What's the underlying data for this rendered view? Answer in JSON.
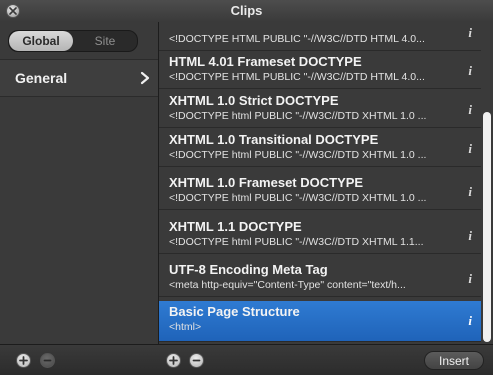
{
  "window": {
    "title": "Clips"
  },
  "scope_tabs": [
    {
      "label": "Global",
      "active": true
    },
    {
      "label": "Site",
      "active": false
    }
  ],
  "categories": [
    {
      "label": "General",
      "selected": true
    }
  ],
  "clips": [
    {
      "name": "",
      "snippet": "<!DOCTYPE HTML PUBLIC \"-//W3C//DTD HTML 4.0...",
      "info": "i",
      "selected": false
    },
    {
      "name": "HTML 4.01 Frameset DOCTYPE",
      "snippet": "<!DOCTYPE HTML PUBLIC \"-//W3C//DTD HTML 4.0...",
      "info": "i",
      "selected": false
    },
    {
      "name": "XHTML 1.0 Strict DOCTYPE",
      "snippet": "<!DOCTYPE html PUBLIC \"-//W3C//DTD XHTML 1.0 ...",
      "info": "i",
      "selected": false
    },
    {
      "name": "XHTML 1.0 Transitional DOCTYPE",
      "snippet": "<!DOCTYPE html PUBLIC \"-//W3C//DTD XHTML 1.0 ...",
      "info": "i",
      "selected": false
    },
    {
      "name": "XHTML 1.0 Frameset DOCTYPE",
      "snippet": "<!DOCTYPE html PUBLIC \"-//W3C//DTD XHTML 1.0 ...",
      "info": "i",
      "selected": false
    },
    {
      "name": "XHTML 1.1 DOCTYPE",
      "snippet": "<!DOCTYPE html PUBLIC \"-//W3C//DTD XHTML 1.1...",
      "info": "i",
      "selected": false
    },
    {
      "name": "UTF-8 Encoding Meta Tag",
      "snippet": "<meta http-equiv=\"Content-Type\" content=\"text/h...",
      "info": "i",
      "selected": false
    },
    {
      "name": "Basic Page Structure",
      "snippet": "<html>",
      "info": "i",
      "selected": true
    }
  ],
  "bottom": {
    "insert_label": "Insert"
  },
  "colors": {
    "selection": "#2a70c6",
    "background": "#343434"
  },
  "icons": {
    "close": "close-icon",
    "chevron": "chevron-right-icon",
    "add": "plus-icon",
    "remove": "minus-icon"
  }
}
